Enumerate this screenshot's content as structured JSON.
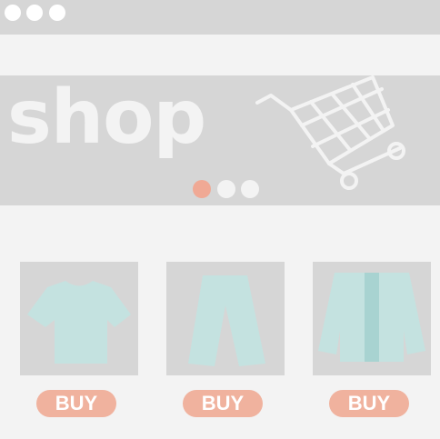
{
  "hero": {
    "title": "shop",
    "carousel": {
      "total_pages": 3,
      "active_page": 1
    }
  },
  "products": [
    {
      "icon": "tshirt-icon",
      "buy_label": "BUY"
    },
    {
      "icon": "pants-icon",
      "buy_label": "BUY"
    },
    {
      "icon": "cardigan-icon",
      "buy_label": "BUY"
    }
  ],
  "colors": {
    "chrome": "#d6d6d6",
    "background": "#f3f3f3",
    "accent": "#f0b29e",
    "garment": "#c4e2e0"
  }
}
